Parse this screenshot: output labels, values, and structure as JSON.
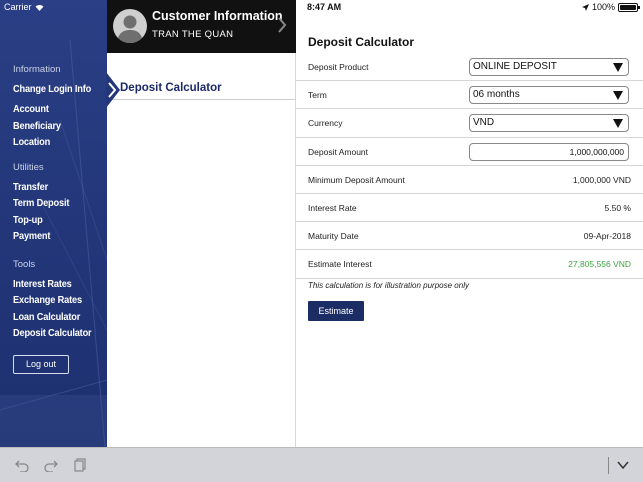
{
  "status_bar": {
    "carrier": "Carrier",
    "time": "8:47 AM",
    "battery": "100%",
    "battery_level": 1.0
  },
  "customer": {
    "title": "Customer Information",
    "name": "TRAN THE  QUAN"
  },
  "sidebar": {
    "groups": [
      {
        "title": "Information",
        "items": [
          "Change Login Info",
          "Account",
          "Beneficiary",
          "Location"
        ]
      },
      {
        "title": "Utilities",
        "items": [
          "Transfer",
          "Term Deposit",
          "Top-up",
          "Payment"
        ]
      },
      {
        "title": "Tools",
        "items": [
          "Interest Rates",
          "Exchange Rates",
          "Loan Calculator",
          "Deposit Calculator"
        ]
      }
    ],
    "logout_label": "Log out"
  },
  "middle": {
    "selected_item": "Deposit Calculator"
  },
  "calculator": {
    "title": "Deposit Calculator",
    "deposit_product": {
      "label": "Deposit Product",
      "value": "ONLINE DEPOSIT"
    },
    "term": {
      "label": "Term",
      "value": "06 months"
    },
    "currency": {
      "label": "Currency",
      "value": "VND"
    },
    "deposit_amount": {
      "label": "Deposit Amount",
      "value": "1,000,000,000"
    },
    "minimum_deposit": {
      "label": "Minimum Deposit Amount",
      "value": "1,000,000 VND"
    },
    "interest_rate": {
      "label": "Interest Rate",
      "value": "5.50 %"
    },
    "maturity_date": {
      "label": "Maturity Date",
      "value": "09-Apr-2018"
    },
    "estimate_interest": {
      "label": "Estimate Interest",
      "value": "27,805,556 VND"
    },
    "note": "This calculation is for illustration purpose only",
    "estimate_button": "Estimate"
  },
  "colors": {
    "sidebar_bg": "#23377a",
    "accent_navy": "#1c2d66",
    "interest_green": "#3aa63f"
  }
}
